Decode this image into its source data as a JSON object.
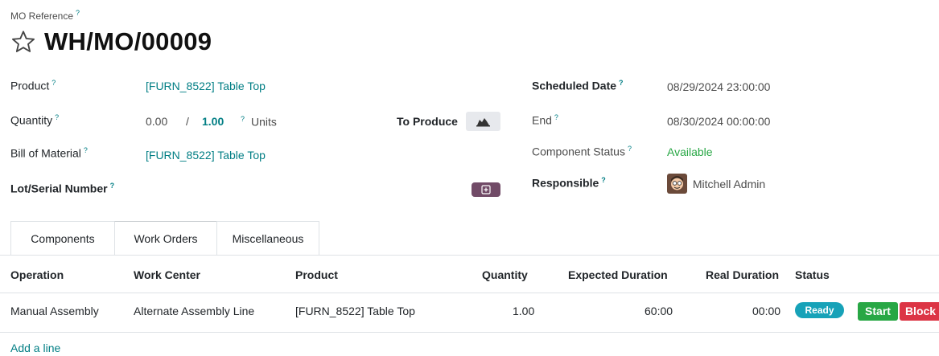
{
  "header": {
    "ref_label": "MO Reference",
    "help_mark": "?",
    "title": "WH/MO/00009"
  },
  "left_fields": {
    "product_label": "Product",
    "product_value": "[FURN_8522] Table Top",
    "quantity_label": "Quantity",
    "quantity_done": "0.00",
    "quantity_sep": "/",
    "quantity_total": "1.00",
    "quantity_uom": "Units",
    "to_produce_label": "To Produce",
    "bom_label": "Bill of Material",
    "bom_value": "[FURN_8522] Table Top",
    "lot_label": "Lot/Serial Number"
  },
  "right_fields": {
    "scheduled_label": "Scheduled Date",
    "scheduled_value": "08/29/2024 23:00:00",
    "end_label": "End",
    "end_value": "08/30/2024 00:00:00",
    "component_status_label": "Component Status",
    "component_status_value": "Available",
    "responsible_label": "Responsible",
    "responsible_value": "Mitchell Admin"
  },
  "tabs": [
    {
      "label": "Components",
      "active": false
    },
    {
      "label": "Work Orders",
      "active": true
    },
    {
      "label": "Miscellaneous",
      "active": false
    }
  ],
  "table": {
    "columns": [
      "Operation",
      "Work Center",
      "Product",
      "Quantity",
      "Expected Duration",
      "Real Duration",
      "Status"
    ],
    "rows": [
      {
        "operation": "Manual Assembly",
        "work_center": "Alternate Assembly Line",
        "product": "[FURN_8522] Table Top",
        "quantity": "1.00",
        "expected_duration": "60:00",
        "real_duration": "00:00",
        "status": "Ready",
        "start_label": "Start",
        "block_label": "Block"
      }
    ],
    "add_line": "Add a line"
  },
  "colors": {
    "link": "#017e84",
    "available": "#28a745",
    "ready": "#17a2b8",
    "start": "#28a745",
    "block": "#dc3545",
    "primary": "#714b67"
  }
}
